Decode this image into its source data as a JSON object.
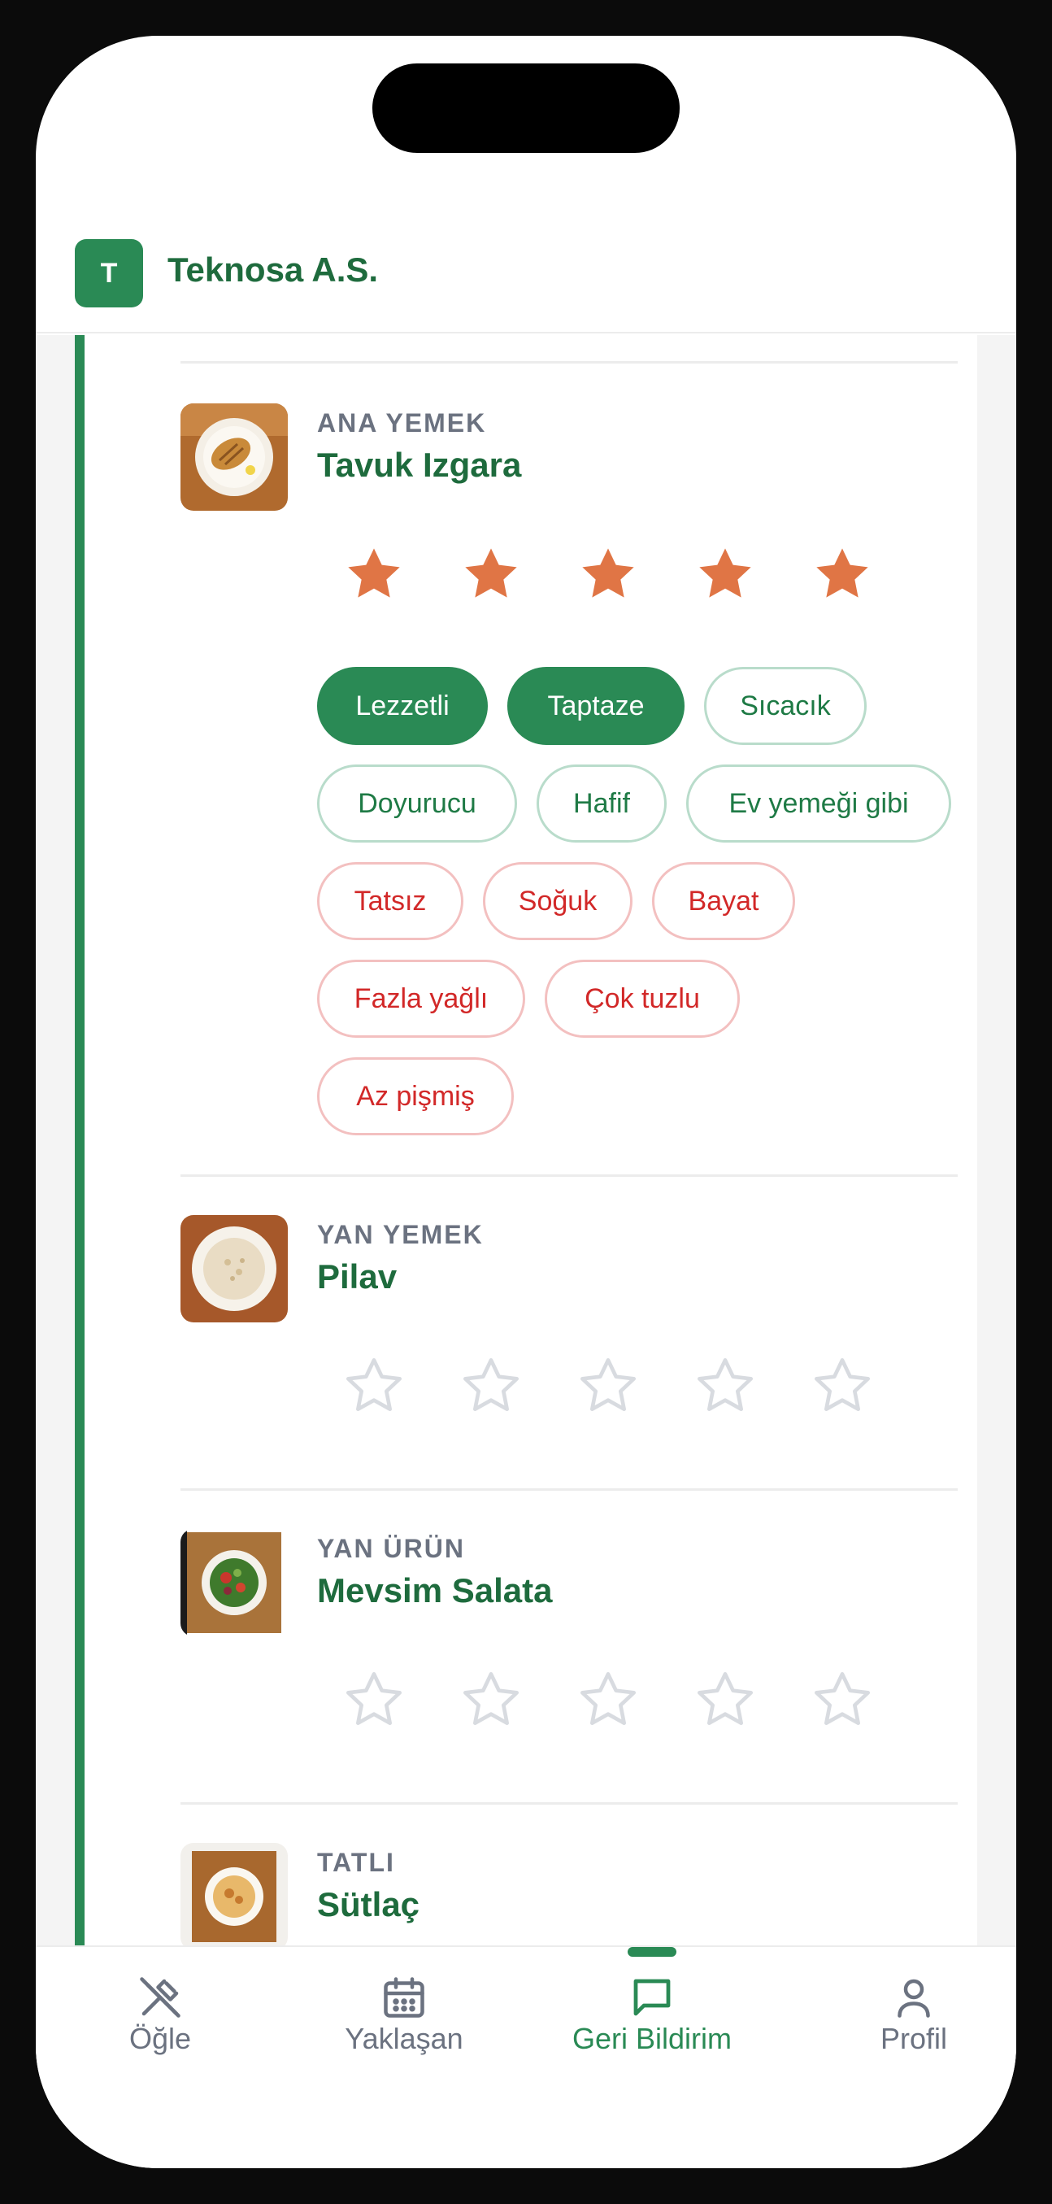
{
  "header": {
    "logo_letter": "T",
    "company_name": "Teknosa A.S."
  },
  "dishes": [
    {
      "category": "ANA YEMEK",
      "name": "Tavuk Izgara",
      "image_icon": "grilled-chicken-plate-image",
      "rating": 5,
      "max_rating": 5,
      "tags_positive": [
        {
          "label": "Lezzetli",
          "selected": true
        },
        {
          "label": "Taptaze",
          "selected": true
        },
        {
          "label": "Sıcacık",
          "selected": false
        },
        {
          "label": "Doyurucu",
          "selected": false
        },
        {
          "label": "Hafif",
          "selected": false
        },
        {
          "label": "Ev yemeği gibi",
          "selected": false
        }
      ],
      "tags_negative": [
        {
          "label": "Tatsız",
          "selected": false
        },
        {
          "label": "Soğuk",
          "selected": false
        },
        {
          "label": "Bayat",
          "selected": false
        },
        {
          "label": "Fazla yağlı",
          "selected": false
        },
        {
          "label": "Çok tuzlu",
          "selected": false
        },
        {
          "label": "Az pişmiş",
          "selected": false
        }
      ]
    },
    {
      "category": "YAN YEMEK",
      "name": "Pilav",
      "image_icon": "rice-bowl-image",
      "rating": 0,
      "max_rating": 5
    },
    {
      "category": "YAN ÜRÜN",
      "name": "Mevsim Salata",
      "image_icon": "salad-bowl-image",
      "rating": 0,
      "max_rating": 5
    },
    {
      "category": "TATLI",
      "name": "Sütlaç",
      "image_icon": "rice-pudding-image",
      "rating": 0,
      "max_rating": 5
    }
  ],
  "colors": {
    "brand_green": "#2a8a55",
    "title_green": "#1e6b3d",
    "star_filled": "#e07545",
    "star_empty": "#d8dbe0",
    "negative_red": "#d22828"
  },
  "nav": {
    "items": [
      {
        "label": "Öğle",
        "icon": "fork-knife-icon",
        "active": false
      },
      {
        "label": "Yaklaşan",
        "icon": "calendar-icon",
        "active": false
      },
      {
        "label": "Geri Bildirim",
        "icon": "chat-bubble-icon",
        "active": true
      },
      {
        "label": "Profil",
        "icon": "person-icon",
        "active": false
      }
    ]
  }
}
